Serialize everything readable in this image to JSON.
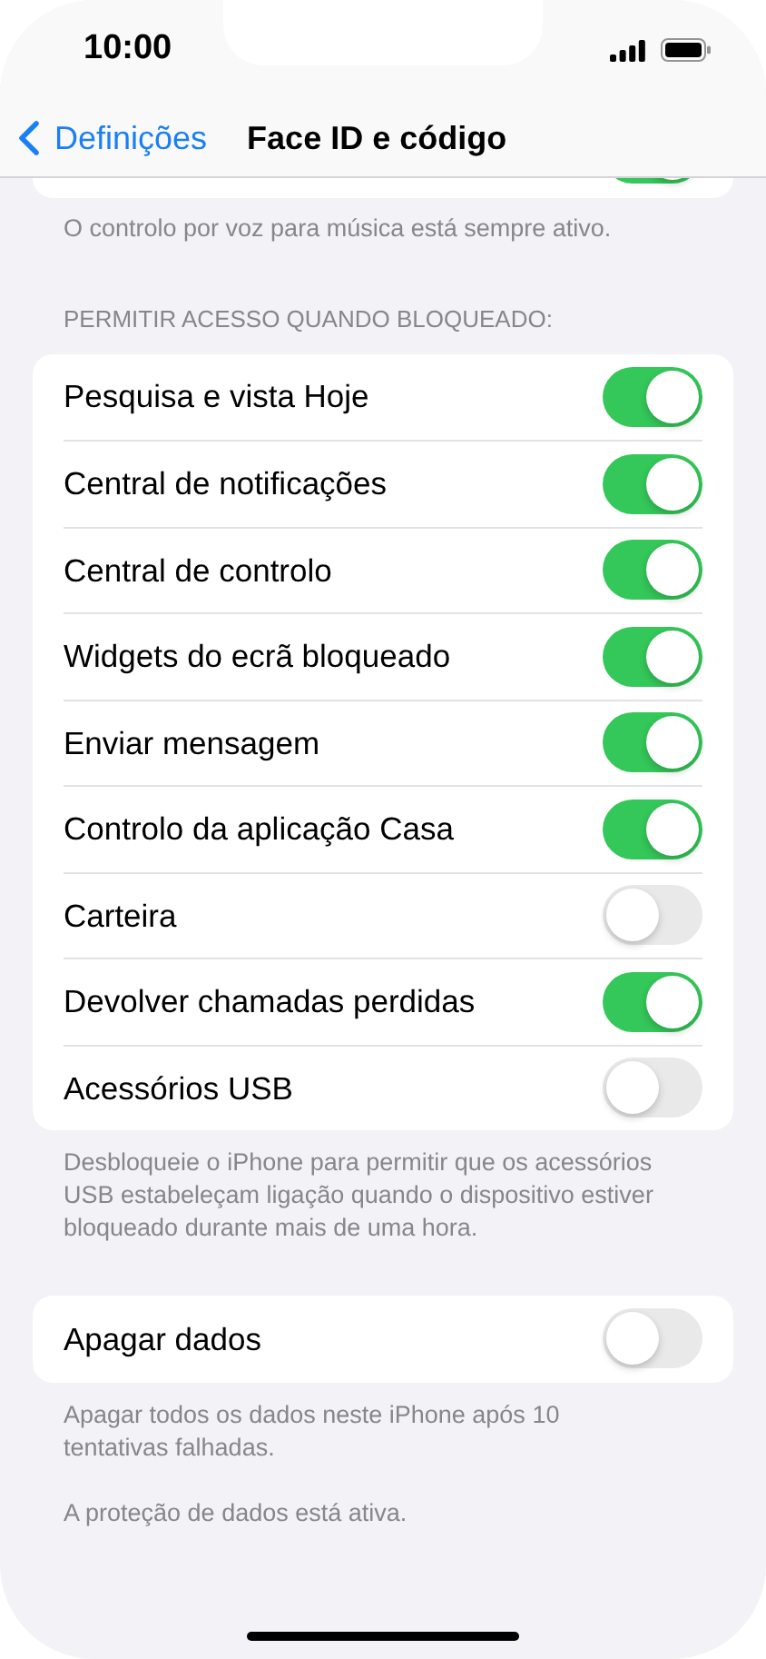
{
  "status_bar": {
    "time": "10:00"
  },
  "nav": {
    "back_label": "Definições",
    "title": "Face ID e código"
  },
  "top_toggle": {
    "on": true
  },
  "top_footer": "O controlo por voz para música está sempre ativo.",
  "section_header": "PERMITIR ACESSO QUANDO BLOQUEADO:",
  "access_items": [
    {
      "label": "Pesquisa e vista Hoje",
      "on": true
    },
    {
      "label": "Central de notificações",
      "on": true
    },
    {
      "label": "Central de controlo",
      "on": true
    },
    {
      "label": "Widgets do ecrã bloqueado",
      "on": true
    },
    {
      "label": "Enviar mensagem",
      "on": true
    },
    {
      "label": "Controlo da aplicação Casa",
      "on": true
    },
    {
      "label": "Carteira",
      "on": false
    },
    {
      "label": "Devolver chamadas perdidas",
      "on": true
    },
    {
      "label": "Acessórios USB",
      "on": false
    }
  ],
  "access_footer": "Desbloqueie o iPhone para permitir que os acessórios USB estabeleçam ligação quando o dispositivo estiver bloqueado durante mais de uma hora.",
  "erase": {
    "label": "Apagar dados",
    "on": false
  },
  "erase_footers": [
    "Apagar todos os dados neste iPhone após 10 tentativas falhadas.",
    "A proteção de dados está ativa."
  ]
}
